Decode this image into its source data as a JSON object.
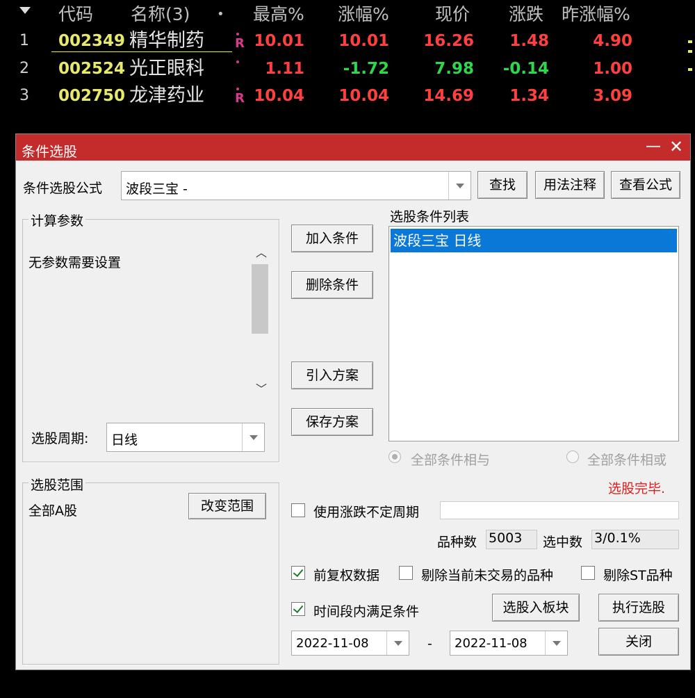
{
  "table": {
    "headers": {
      "code": "代码",
      "name": "名称(3)",
      "dot": "•",
      "high_pct": "最高%",
      "change_pct": "涨幅%",
      "price": "现价",
      "change": "涨跌",
      "prev_change_pct": "昨涨幅%"
    },
    "rows": [
      {
        "idx": "1",
        "code": "002349",
        "name": "精华制药",
        "badge": "R",
        "high_pct": "10.01",
        "change_pct": "10.01",
        "price": "16.26",
        "change": "1.48",
        "prev_change_pct": "4.90"
      },
      {
        "idx": "2",
        "code": "002524",
        "name": "光正眼科",
        "badge": "",
        "high_pct": "1.11",
        "change_pct": "-1.72",
        "price": "7.98",
        "change": "-0.14",
        "prev_change_pct": "1.00"
      },
      {
        "idx": "3",
        "code": "002750",
        "name": "龙津药业",
        "badge": "R",
        "high_pct": "10.04",
        "change_pct": "10.04",
        "price": "14.69",
        "change": "1.34",
        "prev_change_pct": "3.09"
      }
    ]
  },
  "dialog": {
    "title": "条件选股",
    "formula_label": "条件选股公式",
    "formula_value": "波段三宝      -",
    "find_btn": "查找",
    "usage_btn": "用法注释",
    "view_formula_btn": "查看公式",
    "params_group": "计算参数",
    "params_text": "无参数需要设置",
    "period_label": "选股周期:",
    "period_value": "日线",
    "scope_group": "选股范围",
    "scope_value": "全部A股",
    "change_scope_btn": "改变范围",
    "add_cond_btn": "加入条件",
    "del_cond_btn": "删除条件",
    "import_plan_btn": "引入方案",
    "save_plan_btn": "保存方案",
    "cond_list_label": "选股条件列表",
    "cond_items": [
      "波段三宝  日线"
    ],
    "radio_and": "全部条件相与",
    "radio_or": "全部条件相或",
    "status": "选股完毕.",
    "use_variable_period": "使用涨跌不定周期",
    "count_label": "品种数",
    "count_value": "5003",
    "selected_label": "选中数",
    "selected_value": "3/0.1%",
    "forward_adjust": "前复权数据",
    "exclude_untraded": "剔除当前未交易的品种",
    "exclude_st": "剔除ST品种",
    "time_range_cond": "时间段内满足条件",
    "to_block_btn": "选股入板块",
    "execute_btn": "执行选股",
    "date_from": "2022-11-08",
    "date_sep": "-",
    "date_to": "2022-11-08",
    "close_btn": "关闭"
  },
  "colors": {
    "titlebar": "#c42c2c",
    "selection": "#0a78d7",
    "status": "#e02020",
    "up": "#ff4040",
    "down": "#2fd84a",
    "code": "#e8e86a"
  }
}
